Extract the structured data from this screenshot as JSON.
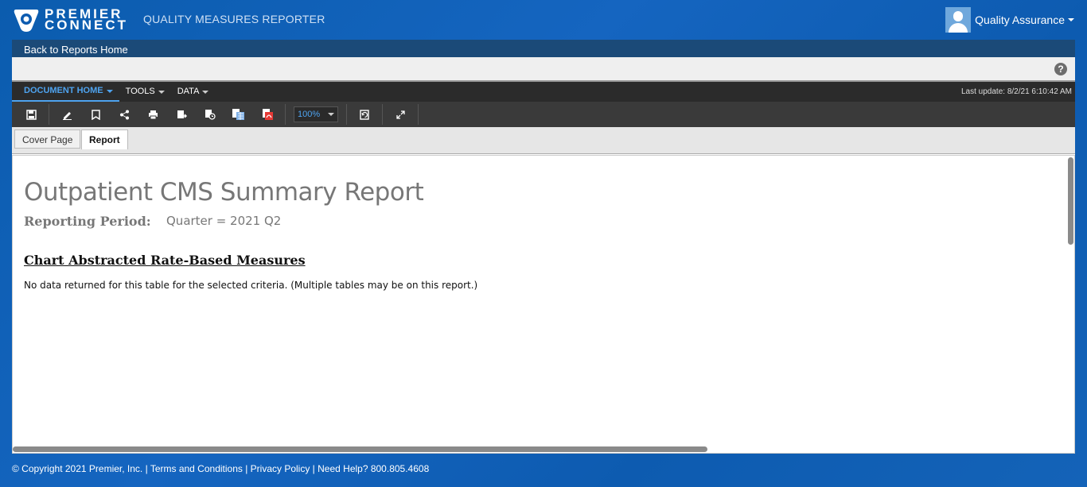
{
  "brand": {
    "line1": "PREMIER",
    "line2": "CONNECT",
    "app_title": "QUALITY MEASURES REPORTER"
  },
  "user": {
    "name": "Quality Assurance"
  },
  "nav": {
    "back_label": "Back to Reports Home",
    "help_label": "?"
  },
  "menu": {
    "items": [
      "DOCUMENT HOME",
      "TOOLS",
      "DATA"
    ],
    "last_update": "Last update: 8/2/21 6:10:42 AM"
  },
  "toolbar": {
    "zoom": "100%",
    "icons": [
      "save-icon",
      "edit-icon",
      "bookmark-icon",
      "share-icon",
      "print-icon",
      "export-icon",
      "schedule-icon",
      "excel-icon",
      "pdf-icon",
      "refresh-icon",
      "fullscreen-icon"
    ]
  },
  "tabs": [
    "Cover Page",
    "Report"
  ],
  "report": {
    "title": "Outpatient CMS Summary Report",
    "period_label": "Reporting Period:",
    "period_value": "Quarter = 2021 Q2",
    "section_heading": "Chart Abstracted Rate-Based Measures",
    "no_data": "No data returned for this table for the selected criteria. (Multiple tables may be on this report.)"
  },
  "footer": {
    "text": "© Copyright 2021 Premier, Inc. | Terms and Conditions | Privacy Policy | Need Help? 800.805.4608"
  }
}
